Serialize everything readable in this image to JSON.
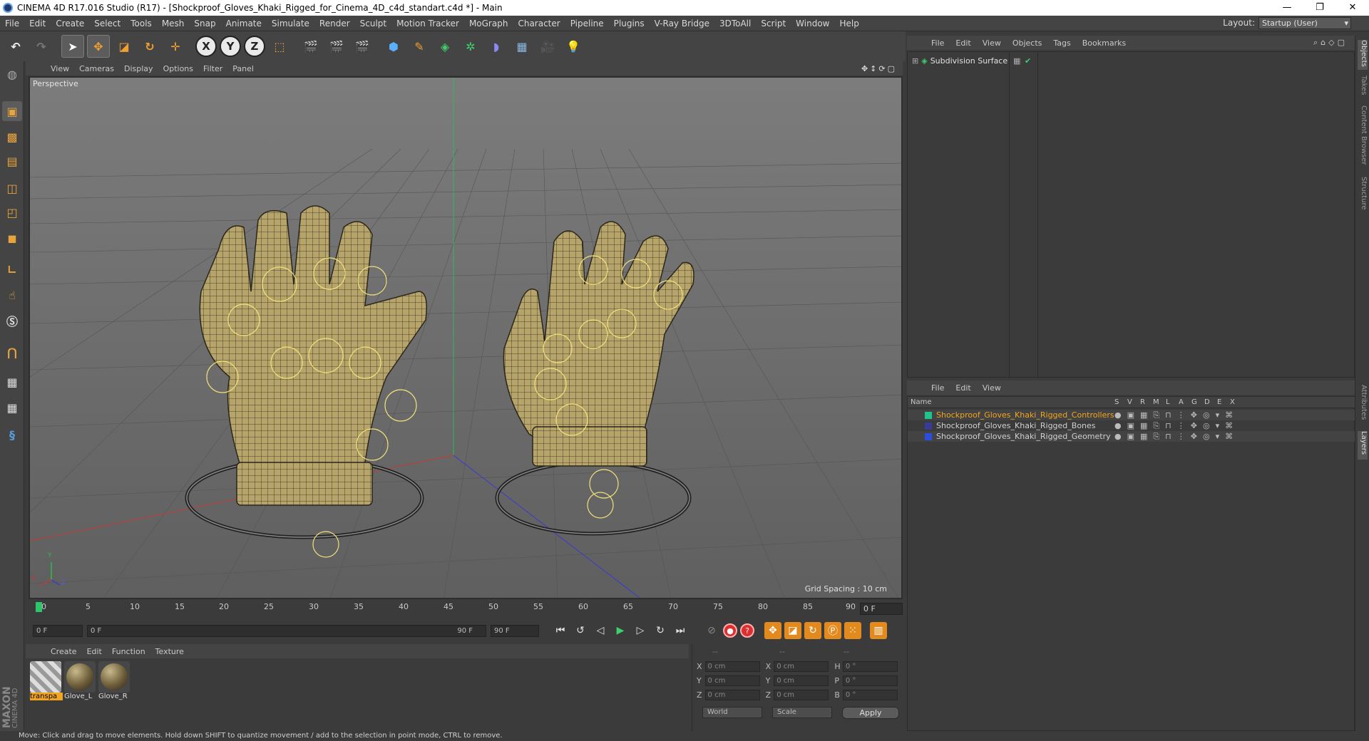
{
  "window": {
    "title": "CINEMA 4D R17.016 Studio (R17) - [Shockproof_Gloves_Khaki_Rigged_for_Cinema_4D_c4d_standart.c4d *] - Main",
    "controls": [
      "—",
      "❐",
      "✕"
    ]
  },
  "menubar": {
    "items": [
      "File",
      "Edit",
      "Create",
      "Select",
      "Tools",
      "Mesh",
      "Snap",
      "Animate",
      "Simulate",
      "Render",
      "Sculpt",
      "Motion Tracker",
      "MoGraph",
      "Character",
      "Pipeline",
      "Plugins",
      "V-Ray Bridge",
      "3DToAll",
      "Script",
      "Window",
      "Help"
    ],
    "layout_label": "Layout:",
    "layout_value": "Startup (User)"
  },
  "toolbar": {
    "x_label": "X",
    "y_label": "Y",
    "z_label": "Z"
  },
  "viewport": {
    "menu": [
      "View",
      "Cameras",
      "Display",
      "Options",
      "Filter",
      "Panel"
    ],
    "label": "Perspective",
    "grid_spacing": "Grid Spacing : 10 cm",
    "axis_y": "Y",
    "axis_x": "X",
    "axis_z": "Z"
  },
  "timeline": {
    "ticks": [
      "0",
      "5",
      "10",
      "15",
      "20",
      "25",
      "30",
      "35",
      "40",
      "45",
      "50",
      "55",
      "60",
      "65",
      "70",
      "75",
      "80",
      "85",
      "90"
    ],
    "current_frame": "0 F"
  },
  "playback": {
    "start_field": "0 F",
    "range_start": "0 F",
    "range_end": "90 F",
    "end_field": "90 F"
  },
  "material_manager": {
    "menu": [
      "Create",
      "Edit",
      "Function",
      "Texture"
    ],
    "materials": [
      {
        "label": "transpa",
        "active": true
      },
      {
        "label": "Glove_L",
        "active": false
      },
      {
        "label": "Glove_R",
        "active": false
      }
    ],
    "logo_line1": "MAXON",
    "logo_line2": "CINEMA 4D"
  },
  "coordinates": {
    "header": [
      "--",
      "--",
      "--"
    ],
    "rows": [
      {
        "a1": "X",
        "v1": "0 cm",
        "a2": "X",
        "v2": "0 cm",
        "a3": "H",
        "v3": "0 °"
      },
      {
        "a1": "Y",
        "v1": "0 cm",
        "a2": "Y",
        "v2": "0 cm",
        "a3": "P",
        "v3": "0 °"
      },
      {
        "a1": "Z",
        "v1": "0 cm",
        "a2": "Z",
        "v2": "0 cm",
        "a3": "B",
        "v3": "0 °"
      }
    ],
    "world": "World",
    "scale": "Scale",
    "apply": "Apply"
  },
  "objects_panel": {
    "menu": [
      "File",
      "Edit",
      "View",
      "Objects",
      "Tags",
      "Bookmarks"
    ],
    "object": "Subdivision Surface"
  },
  "layers_panel": {
    "menu": [
      "File",
      "Edit",
      "View"
    ],
    "columns": [
      "Name",
      "S",
      "V",
      "R",
      "M",
      "L",
      "A",
      "G",
      "D",
      "E",
      "X"
    ],
    "layers": [
      {
        "name": "Shockproof_Gloves_Khaki_Rigged_Controllers",
        "color": "#1fc48a",
        "active": true
      },
      {
        "name": "Shockproof_Gloves_Khaki_Rigged_Bones",
        "color": "#3a3a9a",
        "active": false
      },
      {
        "name": "Shockproof_Gloves_Khaki_Rigged_Geometry",
        "color": "#2a4fe0",
        "active": false
      }
    ]
  },
  "side_tabs": [
    "Objects",
    "Takes",
    "Content Browser",
    "Structure",
    "Attributes",
    "Layers"
  ],
  "statusbar": {
    "text": "Move: Click and drag to move elements. Hold down SHIFT to quantize movement / add to the selection in point mode, CTRL to remove."
  }
}
